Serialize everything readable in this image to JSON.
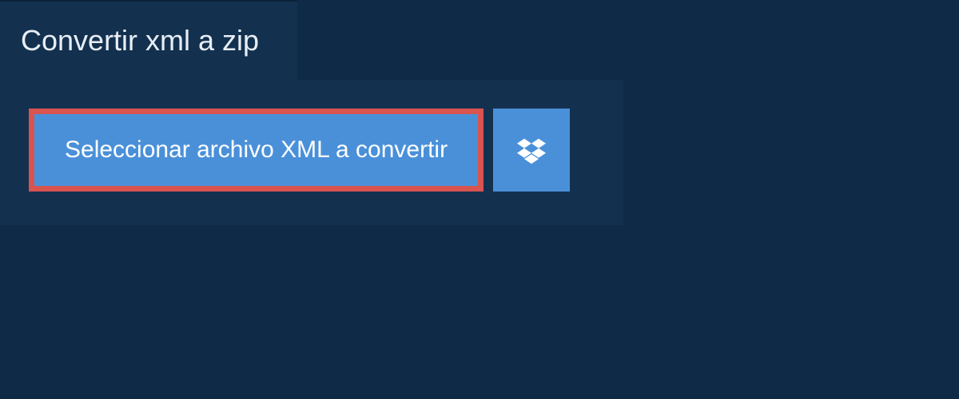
{
  "header": {
    "tab_title": "Convertir xml a zip"
  },
  "upload": {
    "select_file_label": "Seleccionar archivo XML a convertir",
    "dropbox_icon": "dropbox-icon"
  },
  "colors": {
    "background": "#0e2a47",
    "panel": "#13314f",
    "button": "#4a90d9",
    "highlight_border": "#d9534f",
    "text": "#ffffff"
  }
}
